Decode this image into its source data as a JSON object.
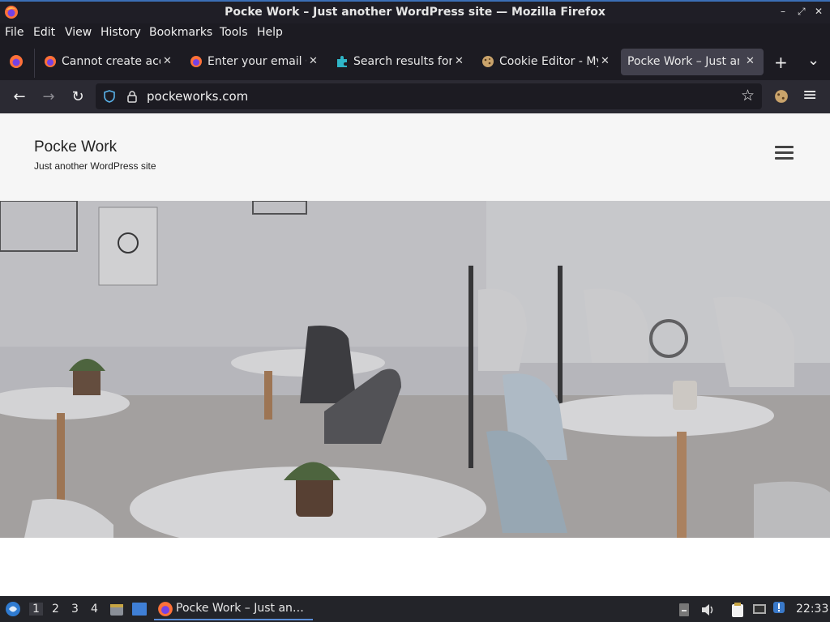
{
  "window": {
    "title": "Pocke Work – Just another WordPress site — Mozilla Firefox",
    "controls": {
      "minimize": "–",
      "restore": "⤢",
      "close": "✕"
    }
  },
  "menubar": {
    "items": [
      "File",
      "Edit",
      "View",
      "History",
      "Bookmarks",
      "Tools",
      "Help"
    ]
  },
  "tabs": [
    {
      "label": "Cannot create acc",
      "icon": "firefox-icon",
      "active": false
    },
    {
      "label": "Enter your email C",
      "icon": "firefox-icon",
      "active": false
    },
    {
      "label": "Search results for",
      "icon": "puzzle-icon",
      "active": false
    },
    {
      "label": "Cookie Editor - My",
      "icon": "cookie-icon",
      "active": false
    },
    {
      "label": "Pocke Work – Just anc",
      "icon": "none",
      "active": true
    }
  ],
  "tab_controls": {
    "new_tab": "+",
    "list_all": "⌄"
  },
  "navbar": {
    "back": "←",
    "forward": "→",
    "reload": "↻",
    "url": "pockeworks.com",
    "bookmark": "☆",
    "menu": "≡"
  },
  "site": {
    "title": "Pocke Work",
    "description": "Just another WordPress site"
  },
  "taskbar": {
    "workspaces": [
      "1",
      "2",
      "3",
      "4"
    ],
    "active_workspace": "1",
    "task_label": "Pocke Work – Just an…",
    "clock": "22:33"
  },
  "colors": {
    "accent": "#5a8dd6",
    "firefox_orange": "#ff7139",
    "tab_active": "#42414d"
  }
}
